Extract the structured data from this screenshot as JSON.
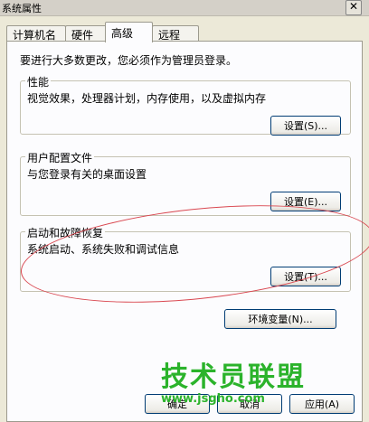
{
  "window": {
    "title": "系统属性"
  },
  "tabs": [
    {
      "label": "计算机名"
    },
    {
      "label": "硬件"
    },
    {
      "label": "高级"
    },
    {
      "label": "远程"
    }
  ],
  "advanced": {
    "intro": "要进行大多数更改，您必须作为管理员登录。",
    "performance": {
      "title": "性能",
      "description": "视觉效果，处理器计划，内存使用，以及虚拟内存",
      "button": "设置(S)..."
    },
    "profiles": {
      "title": "用户配置文件",
      "description": "与您登录有关的桌面设置",
      "button": "设置(E)..."
    },
    "startup": {
      "title": "启动和故障恢复",
      "description": "系统启动、系统失败和调试信息",
      "button": "设置(T)..."
    },
    "env_button": "环境变量(N)..."
  },
  "footer": {
    "ok": "确定",
    "cancel": "取消",
    "apply": "应用(A)"
  },
  "watermark": {
    "brand": "技术员联盟",
    "url": "www.jsgho.com"
  }
}
